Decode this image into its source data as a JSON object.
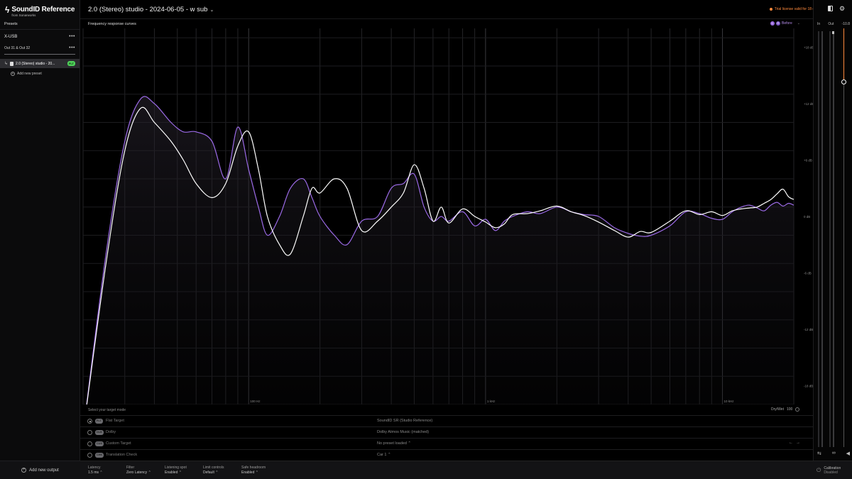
{
  "app": {
    "logo_title": "SoundID Reference",
    "logo_sub": "from Sonarworks"
  },
  "sidebar": {
    "presets_label": "Presets",
    "device_name": "X-USB",
    "output_name": "Out 31 & Out 32",
    "selected_preset": "2.0 (Stereo) studio - 20...",
    "selected_preset_badge": "FLT",
    "add_preset": "Add new preset",
    "add_output": "Add new output"
  },
  "header": {
    "title": "2.0 (Stereo) studio - 2024-06-05 - w sub",
    "trial_notice": "Trial license valid for 18 days"
  },
  "meters": {
    "in_label": "In",
    "out_label": "Out",
    "volume_value": "-10.8"
  },
  "chart": {
    "title": "Frequency response curves",
    "legend_label": "Before",
    "legend_left": "L",
    "legend_right": "R"
  },
  "chart_data": {
    "type": "line",
    "title": "Frequency response curves",
    "x_scale": "log",
    "x_unit": "Hz",
    "xlim": [
      20,
      20000
    ],
    "x_tick_labels": [
      "100 Hz",
      "1 kHz",
      "10 kHz"
    ],
    "ylim": [
      -20,
      20
    ],
    "y_unit": "dB",
    "y_tick_labels": [
      "+18 dB",
      "+12 dB",
      "+6 dB",
      "0 dB",
      "-6 dB",
      "-12 dB",
      "-18 dB"
    ],
    "y_tick_values": [
      18,
      12,
      6,
      0,
      -6,
      -12,
      -18
    ],
    "grid": true,
    "legend": "top-right",
    "series": [
      {
        "name": "L",
        "color": "#9b6ae6",
        "x": [
          20,
          25,
          30,
          35,
          40,
          47,
          53,
          60,
          70,
          80,
          90,
          100,
          110,
          120,
          135,
          150,
          170,
          185,
          200,
          230,
          260,
          300,
          350,
          400,
          450,
          500,
          550,
          600,
          650,
          700,
          800,
          900,
          1000,
          1100,
          1200,
          1300,
          1500,
          1700,
          2000,
          2300,
          2600,
          3000,
          3500,
          4000,
          4500,
          5000,
          6000,
          7000,
          8000,
          9000,
          10000,
          11000,
          12000,
          13000,
          14000,
          15000,
          16000,
          17000,
          18000,
          19000,
          20000
        ],
        "y": [
          -23,
          -4,
          8,
          12.5,
          12,
          10,
          9,
          9,
          8,
          4,
          9.5,
          5,
          1,
          -2,
          0,
          3,
          4,
          2,
          0,
          -2,
          -3,
          -0.5,
          0,
          3,
          3.5,
          4.5,
          1,
          -0.5,
          0,
          -0.5,
          0.5,
          -1,
          -0.3,
          -1.5,
          -0.5,
          0,
          0.5,
          0.3,
          1,
          0.5,
          0.2,
          0,
          -1.2,
          -1.8,
          -2.1,
          -2,
          -1,
          0.5,
          0.3,
          -0.2,
          -0.3,
          0.5,
          1,
          1.2,
          0.9,
          0.6,
          1.2,
          1.5,
          1.1,
          1.4,
          1.2
        ]
      },
      {
        "name": "R",
        "color": "#ffffff",
        "x": [
          20,
          25,
          30,
          35,
          40,
          47,
          53,
          60,
          70,
          80,
          90,
          100,
          110,
          120,
          135,
          150,
          170,
          185,
          200,
          230,
          260,
          300,
          350,
          400,
          450,
          500,
          550,
          600,
          650,
          700,
          800,
          900,
          1000,
          1100,
          1200,
          1300,
          1500,
          1700,
          2000,
          2300,
          2600,
          3000,
          3500,
          4000,
          4500,
          5000,
          6000,
          7000,
          8000,
          9000,
          10000,
          11000,
          12000,
          13000,
          14000,
          15000,
          16000,
          17000,
          18000,
          19000,
          20000
        ],
        "y": [
          -23,
          -5,
          7,
          11.5,
          10,
          8,
          6,
          3.5,
          2,
          3.5,
          7.5,
          9,
          5,
          0,
          -3,
          -4,
          0,
          3,
          2.5,
          4,
          3,
          -1.5,
          -0.5,
          1,
          2.5,
          5.5,
          3,
          -0.5,
          1,
          -0.7,
          0.8,
          0,
          -0.6,
          -1.2,
          -0.8,
          0.2,
          0.3,
          0.6,
          1.1,
          0.5,
          0.1,
          -0.6,
          -1.5,
          -2.2,
          -1.6,
          -1.7,
          -0.5,
          0.6,
          0.2,
          0.5,
          0.1,
          0.6,
          0.8,
          0.9,
          1,
          1.4,
          1.8,
          2.4,
          2.9,
          2.1,
          1.8
        ]
      }
    ]
  },
  "target": {
    "heading": "Select your target mode",
    "drywet_label": "Dry/Wet",
    "drywet_value": "100",
    "rows": [
      {
        "tag": "FLT",
        "name": "Flat Target",
        "value": "SoundID SR (Studio Reference)",
        "selected": true
      },
      {
        "tag": "DLB",
        "name": "Dolby",
        "value": "Dolby Atmos Music (matched)",
        "selected": false
      },
      {
        "tag": "CUS",
        "name": "Custom Target",
        "value": "No preset loaded",
        "selected": false
      },
      {
        "tag": "CHK",
        "name": "Translation Check",
        "value": "Car 1",
        "selected": false
      }
    ]
  },
  "bottom": {
    "latency_label": "Latency",
    "latency_value": "1.5 ms",
    "filter_label": "Filter",
    "filter_value": "Zero Latency",
    "spot_label": "Listening spot",
    "spot_value": "Enabled",
    "limit_label": "Limit controls",
    "limit_value": "Default",
    "headroom_label": "Safe headroom",
    "headroom_value": "Enabled",
    "calibration_label": "Calibration",
    "calibration_value": "Disabled"
  }
}
